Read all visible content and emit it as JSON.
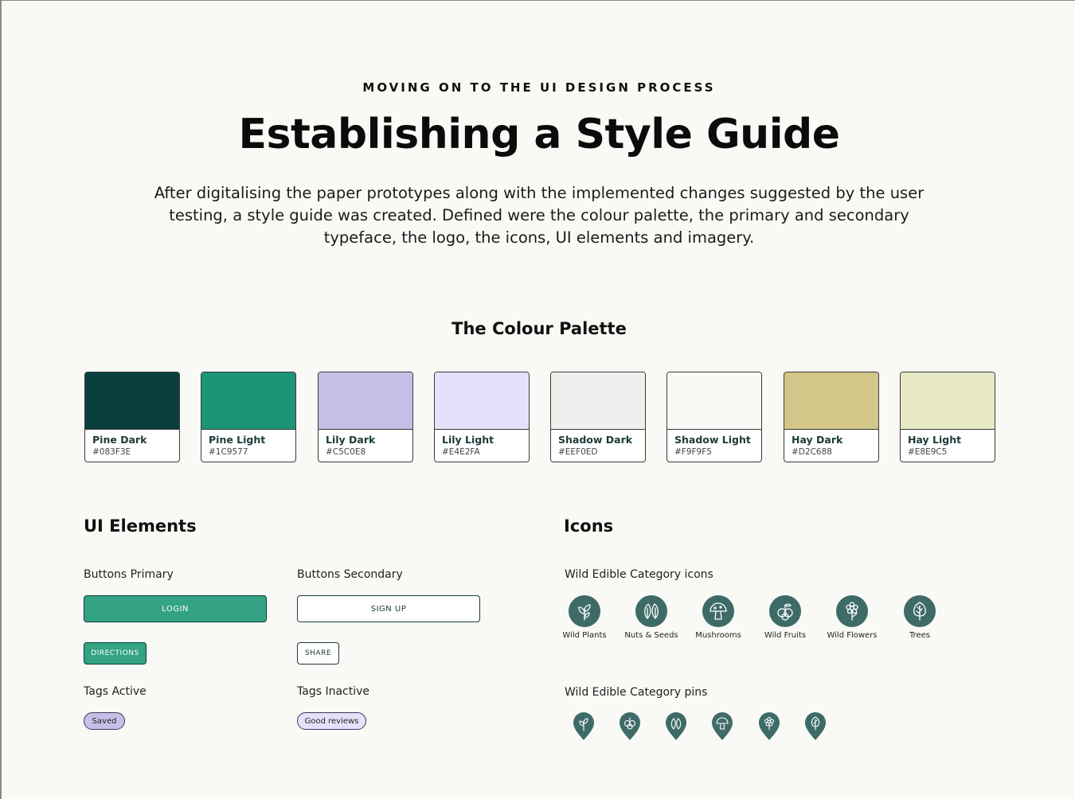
{
  "header": {
    "eyebrow": "MOVING ON TO THE UI DESIGN PROCESS",
    "title": "Establishing a Style Guide",
    "intro": "After digitalising the paper prototypes along with the implemented changes suggested by the user testing, a style guide was created. Defined were the colour palette, the primary and secondary typeface, the logo, the icons, UI elements and imagery."
  },
  "palette": {
    "title": "The Colour Palette",
    "swatches": [
      {
        "name": "Pine Dark",
        "hex": "#083F3E",
        "color": "#083F3E"
      },
      {
        "name": "Pine Light",
        "hex": "#1C9577",
        "color": "#1C9577"
      },
      {
        "name": "Lily Dark",
        "hex": "#C5C0E8",
        "color": "#C5C0E8"
      },
      {
        "name": "Lily Light",
        "hex": "#E4E2FA",
        "color": "#E4E2FA"
      },
      {
        "name": "Shadow Dark",
        "hex": "#EEF0ED",
        "color": "#EEF0ED"
      },
      {
        "name": "Shadow Light",
        "hex": "#F9F9F5",
        "color": "#F9F9F5"
      },
      {
        "name": "Hay Dark",
        "hex": "#D2C688",
        "color": "#D2C688"
      },
      {
        "name": "Hay Light",
        "hex": "#E8E9C5",
        "color": "#E8E9C5"
      }
    ]
  },
  "ui_elements": {
    "title": "UI Elements",
    "buttons_primary_label": "Buttons Primary",
    "buttons_secondary_label": "Buttons Secondary",
    "login": "LOGIN",
    "sign_up": "SIGN UP",
    "directions": "DIRECTIONS",
    "share": "SHARE",
    "tags_active_label": "Tags Active",
    "tags_inactive_label": "Tags Inactive",
    "tag_saved": "Saved",
    "tag_good_reviews": "Good reviews"
  },
  "icons": {
    "title": "Icons",
    "category_icons_label": "Wild Edible Category icons",
    "category_pins_label": "Wild Edible Category pins",
    "categories": [
      {
        "label": "Wild Plants",
        "icon": "plant-icon"
      },
      {
        "label": "Nuts & Seeds",
        "icon": "seeds-icon"
      },
      {
        "label": "Mushrooms",
        "icon": "mushroom-icon"
      },
      {
        "label": "Wild Fruits",
        "icon": "fruit-icon"
      },
      {
        "label": "Wild Flowers",
        "icon": "flower-icon"
      },
      {
        "label": "Trees",
        "icon": "tree-icon"
      }
    ],
    "pins": [
      "plant-pin",
      "fruit-pin",
      "seeds-pin",
      "mushroom-pin",
      "flower-pin",
      "tree-pin"
    ],
    "icon_color": "#3E6B67"
  }
}
